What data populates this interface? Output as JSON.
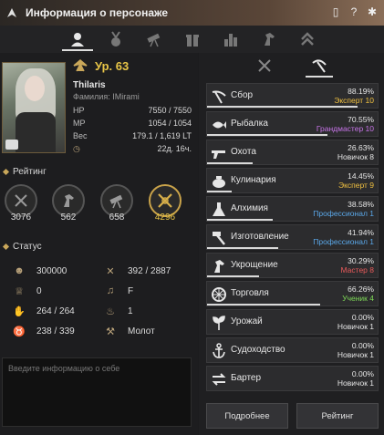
{
  "window": {
    "title": "Информация о персонаже"
  },
  "tabs": [
    {
      "icon": "profile-icon",
      "active": true
    },
    {
      "icon": "medal-icon",
      "active": false
    },
    {
      "icon": "telescope-icon",
      "active": false
    },
    {
      "icon": "gift-icon",
      "active": false
    },
    {
      "icon": "bar-chart-icon",
      "active": false
    },
    {
      "icon": "horse-icon",
      "active": false
    },
    {
      "icon": "chevrons-up-icon",
      "active": false
    }
  ],
  "character": {
    "level": "Ур. 63",
    "name": "Thilaris",
    "family": "Фамилия: IMirami",
    "stats": [
      {
        "label": "HP",
        "value": "7550 / 7550"
      },
      {
        "label": "MP",
        "value": "1054 / 1054"
      },
      {
        "label": "Вес",
        "value": "179.1 / 1,619 LT"
      },
      {
        "label": "",
        "value": "22д. 16ч."
      }
    ]
  },
  "rating": {
    "title": "Рейтинг",
    "items": [
      {
        "value": "3076",
        "icon": "swords-icon",
        "highlight": false
      },
      {
        "value": "562",
        "icon": "horse-icon",
        "highlight": false
      },
      {
        "value": "658",
        "icon": "telescope-icon",
        "highlight": false
      },
      {
        "value": "4296",
        "icon": "crossed-swords-icon",
        "highlight": true
      }
    ]
  },
  "status": {
    "title": "Статус",
    "items": [
      {
        "icon": "energy-icon",
        "value": "300000"
      },
      {
        "icon": "tools-icon",
        "value": "392 / 2887"
      },
      {
        "icon": "ring-icon",
        "value": "0"
      },
      {
        "icon": "music-icon",
        "value": "F"
      },
      {
        "icon": "hand-icon",
        "value": "264 / 264"
      },
      {
        "icon": "flame-icon",
        "value": "1"
      },
      {
        "icon": "karma-icon",
        "value": "238 / 339"
      },
      {
        "icon": "hammer-icon",
        "value": "Молот"
      }
    ]
  },
  "intro": {
    "placeholder": "Введите информацию о себе"
  },
  "life_skills": {
    "tabs": [
      "crossed-swords-icon",
      "pickaxe-icon"
    ],
    "items": [
      {
        "name": "Сбор",
        "pct": "88.19%",
        "rank": "Эксперт 10",
        "rank_color": "#f0c040",
        "progress": 88.19,
        "icon": "scythe-icon"
      },
      {
        "name": "Рыбалка",
        "pct": "70.55%",
        "rank": "Грандмастер 10",
        "rank_color": "#c774e8",
        "progress": 70.55,
        "icon": "fish-icon"
      },
      {
        "name": "Охота",
        "pct": "26.63%",
        "rank": "Новичок 8",
        "rank_color": "#e6e6e6",
        "progress": 26.63,
        "icon": "gun-icon"
      },
      {
        "name": "Кулинария",
        "pct": "14.45%",
        "rank": "Эксперт 9",
        "rank_color": "#f0c040",
        "progress": 14.45,
        "icon": "pot-icon"
      },
      {
        "name": "Алхимия",
        "pct": "38.58%",
        "rank": "Профессионал 1",
        "rank_color": "#5aa7e8",
        "progress": 38.58,
        "icon": "flask-icon"
      },
      {
        "name": "Изготовление",
        "pct": "41.94%",
        "rank": "Профессионал 1",
        "rank_color": "#5aa7e8",
        "progress": 41.94,
        "icon": "hammer-icon"
      },
      {
        "name": "Укрощение",
        "pct": "30.29%",
        "rank": "Мастер 8",
        "rank_color": "#e85a5a",
        "progress": 30.29,
        "icon": "horse-icon"
      },
      {
        "name": "Торговля",
        "pct": "66.26%",
        "rank": "Ученик 4",
        "rank_color": "#7ed957",
        "progress": 66.26,
        "icon": "wheel-icon"
      },
      {
        "name": "Урожай",
        "pct": "0.00%",
        "rank": "Новичок 1",
        "rank_color": "#e6e6e6",
        "progress": 0,
        "icon": "sprout-icon"
      },
      {
        "name": "Судоходство",
        "pct": "0.00%",
        "rank": "Новичок 1",
        "rank_color": "#e6e6e6",
        "progress": 0,
        "icon": "anchor-icon"
      },
      {
        "name": "Бартер",
        "pct": "0.00%",
        "rank": "Новичок 1",
        "rank_color": "#e6e6e6",
        "progress": 0,
        "icon": "exchange-icon"
      }
    ]
  },
  "buttons": {
    "details": "Подробнее",
    "ranking": "Рейтинг"
  }
}
